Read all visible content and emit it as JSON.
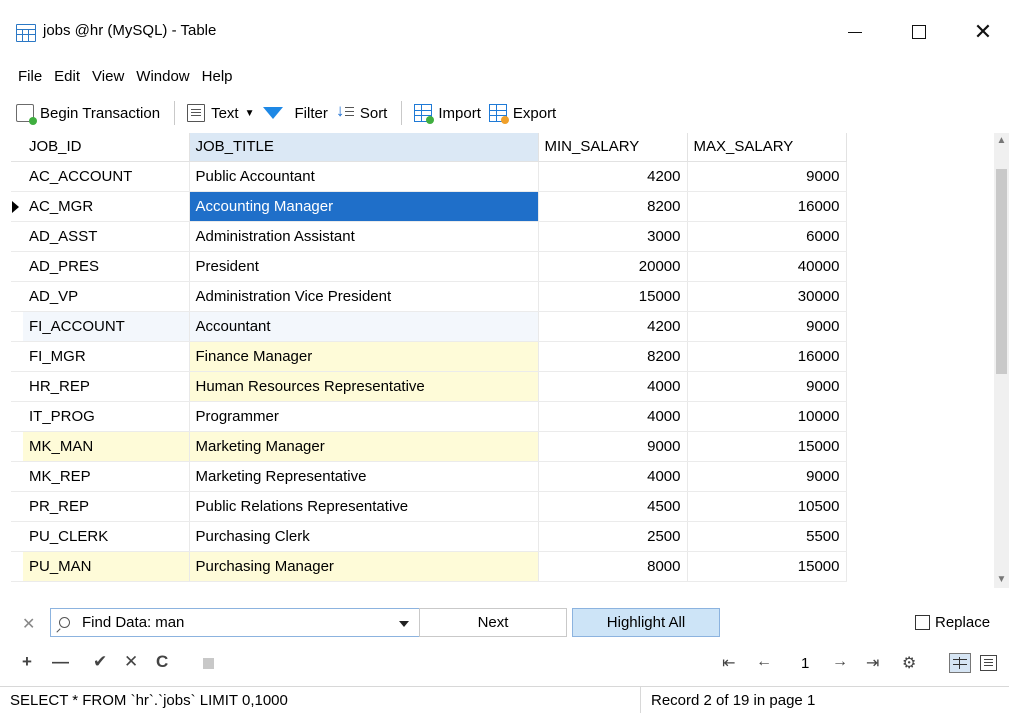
{
  "window": {
    "title": "jobs @hr (MySQL) - Table",
    "minimize": "—",
    "maximize": "□",
    "close": "✕"
  },
  "menu": [
    "File",
    "Edit",
    "View",
    "Window",
    "Help"
  ],
  "toolbar": {
    "begin_transaction": "Begin Transaction",
    "text": "Text",
    "filter": "Filter",
    "sort": "Sort",
    "import": "Import",
    "export": "Export"
  },
  "grid": {
    "columns": [
      "JOB_ID",
      "JOB_TITLE",
      "MIN_SALARY",
      "MAX_SALARY"
    ],
    "rows": [
      {
        "job_id": "AC_ACCOUNT",
        "job_title": "Public Accountant",
        "min_salary": "4200",
        "max_salary": "9000"
      },
      {
        "job_id": "AC_MGR",
        "job_title": "Accounting Manager",
        "min_salary": "8200",
        "max_salary": "16000"
      },
      {
        "job_id": "AD_ASST",
        "job_title": "Administration Assistant",
        "min_salary": "3000",
        "max_salary": "6000"
      },
      {
        "job_id": "AD_PRES",
        "job_title": "President",
        "min_salary": "20000",
        "max_salary": "40000"
      },
      {
        "job_id": "AD_VP",
        "job_title": "Administration Vice President",
        "min_salary": "15000",
        "max_salary": "30000"
      },
      {
        "job_id": "FI_ACCOUNT",
        "job_title": "Accountant",
        "min_salary": "4200",
        "max_salary": "9000"
      },
      {
        "job_id": "FI_MGR",
        "job_title": "Finance Manager",
        "min_salary": "8200",
        "max_salary": "16000"
      },
      {
        "job_id": "HR_REP",
        "job_title": "Human Resources Representative",
        "min_salary": "4000",
        "max_salary": "9000"
      },
      {
        "job_id": "IT_PROG",
        "job_title": "Programmer",
        "min_salary": "4000",
        "max_salary": "10000"
      },
      {
        "job_id": "MK_MAN",
        "job_title": "Marketing Manager",
        "min_salary": "9000",
        "max_salary": "15000"
      },
      {
        "job_id": "MK_REP",
        "job_title": "Marketing Representative",
        "min_salary": "4000",
        "max_salary": "9000"
      },
      {
        "job_id": "PR_REP",
        "job_title": "Public Relations Representative",
        "min_salary": "4500",
        "max_salary": "10500"
      },
      {
        "job_id": "PU_CLERK",
        "job_title": "Purchasing Clerk",
        "min_salary": "2500",
        "max_salary": "5500"
      },
      {
        "job_id": "PU_MAN",
        "job_title": "Purchasing Manager",
        "min_salary": "8000",
        "max_salary": "15000"
      }
    ]
  },
  "find": {
    "label": "Find Data:",
    "value": "man",
    "next": "Next",
    "highlight_all": "Highlight All",
    "replace": "Replace"
  },
  "nav": {
    "page": "1"
  },
  "status": {
    "sql": "SELECT * FROM `hr`.`jobs` LIMIT 0,1000",
    "record": "Record 2 of 19 in page 1"
  },
  "colors": {
    "selection": "#1f6fc9",
    "match_highlight": "#fefbd8",
    "active_header": "#dbe8f5",
    "find_border": "#8cb3df"
  }
}
